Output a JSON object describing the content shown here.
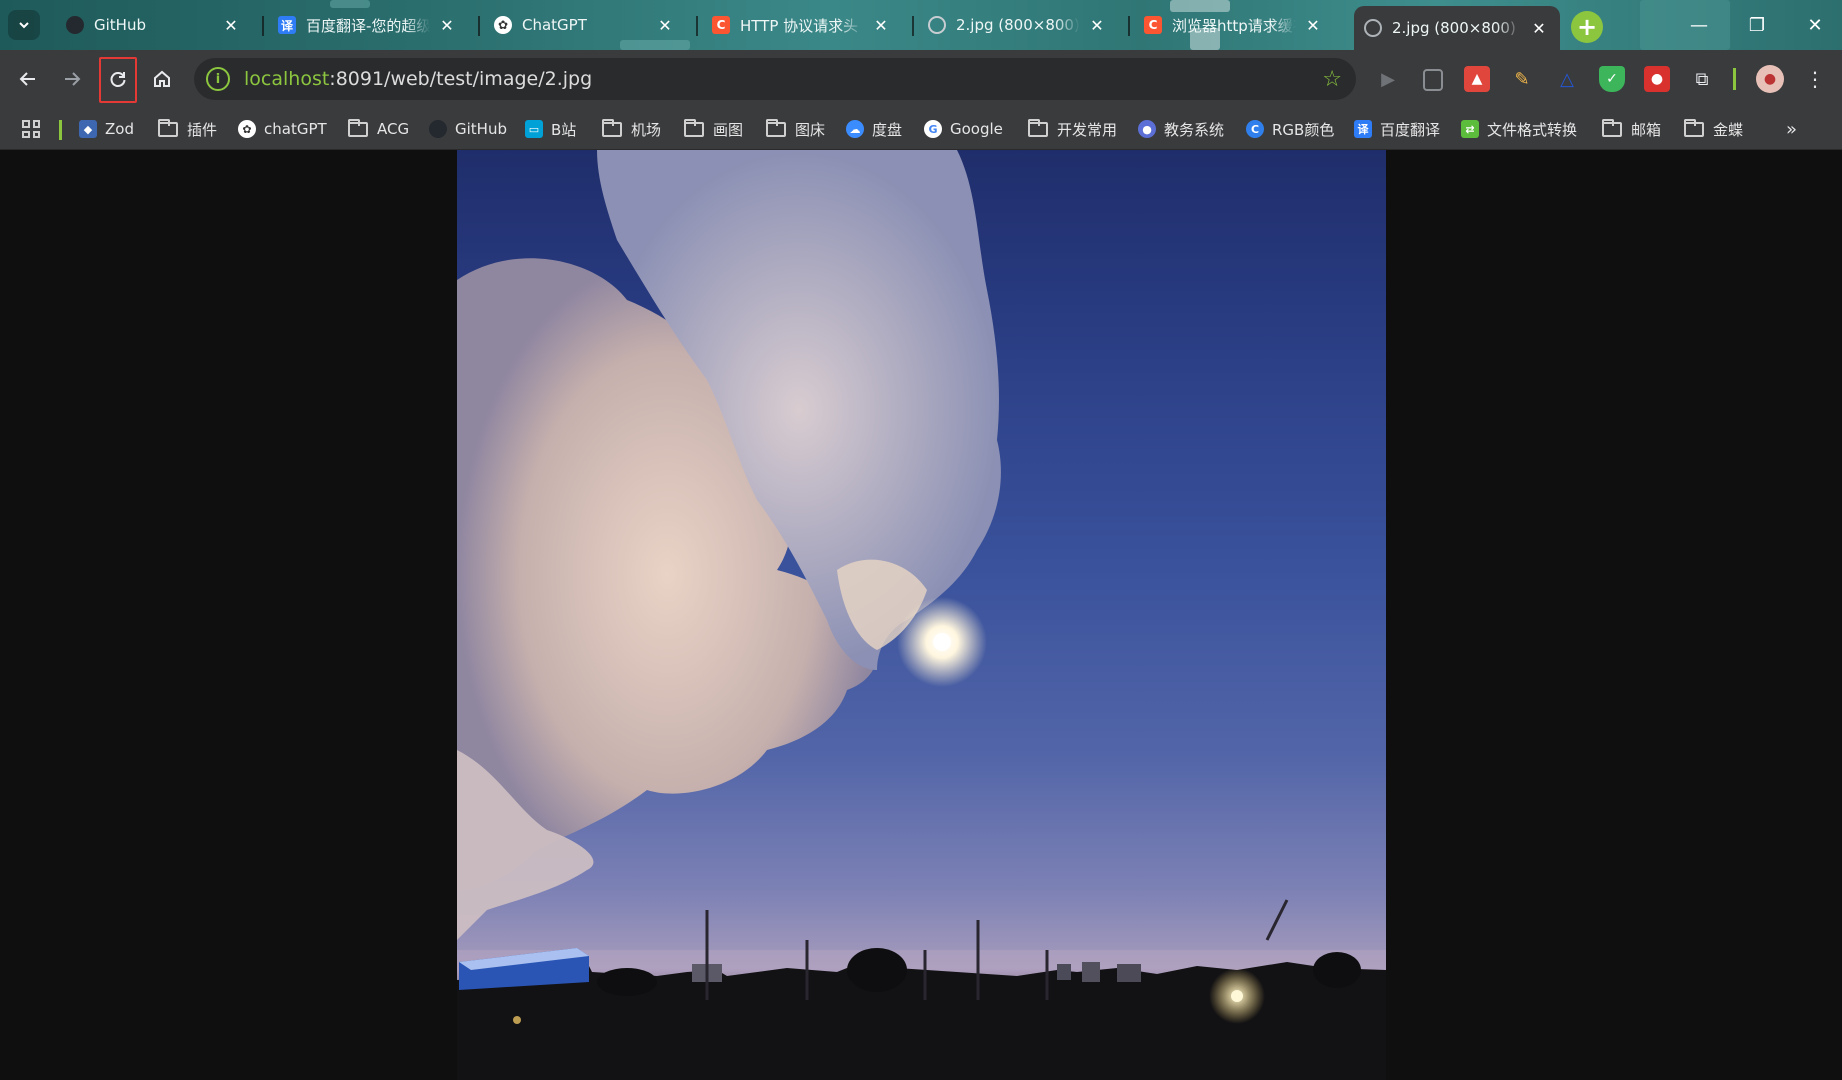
{
  "tabs": [
    {
      "title": "GitHub",
      "icon": "github-icon",
      "color": "#24292f"
    },
    {
      "title": "百度翻译-您的超级",
      "icon": "baidu-translate-icon",
      "glyph": "译",
      "color": "#2e7cf6"
    },
    {
      "title": "ChatGPT",
      "icon": "chatgpt-icon",
      "color": "#ffffff"
    },
    {
      "title": "HTTP 协议请求头",
      "icon": "csdn-icon",
      "glyph": "C",
      "color": "#fc5531"
    },
    {
      "title": "2.jpg (800×800)",
      "icon": "globe-icon",
      "color": "#9aa0a6"
    },
    {
      "title": "浏览器http请求缓存",
      "icon": "csdn-icon",
      "glyph": "C",
      "color": "#fc5531"
    },
    {
      "title": "2.jpg (800×800)",
      "icon": "globe-icon",
      "color": "#9aa0a6",
      "active": true
    }
  ],
  "address": {
    "host": "localhost",
    "path": ":8091/web/test/image/2.jpg"
  },
  "bookmarks": [
    {
      "label": "Zod",
      "icon": "zod-icon",
      "color": "#3e67b1"
    },
    {
      "label": "插件",
      "icon": "folder-icon"
    },
    {
      "label": "chatGPT",
      "icon": "chatgpt-icon",
      "color": "#ffffff"
    },
    {
      "label": "ACG",
      "icon": "folder-icon"
    },
    {
      "label": "GitHub",
      "icon": "github-icon",
      "color": "#24292f"
    },
    {
      "label": "B站",
      "icon": "bilibili-icon",
      "color": "#00a1d6"
    },
    {
      "label": "机场",
      "icon": "folder-icon"
    },
    {
      "label": "画图",
      "icon": "folder-icon"
    },
    {
      "label": "图床",
      "icon": "folder-icon"
    },
    {
      "label": "度盘",
      "icon": "baidu-pan-icon",
      "color": "#3b8cff"
    },
    {
      "label": "Google",
      "icon": "google-icon",
      "color": "#ffffff"
    },
    {
      "label": "开发常用",
      "icon": "folder-icon"
    },
    {
      "label": "教务系统",
      "icon": "school-icon",
      "color": "#5b6fd6"
    },
    {
      "label": "RGB颜色",
      "icon": "rgb-icon",
      "color": "#2f80ed"
    },
    {
      "label": "百度翻译",
      "icon": "baidu-translate-icon",
      "glyph": "译",
      "color": "#2e7cf6"
    },
    {
      "label": "文件格式转换",
      "icon": "convert-icon",
      "color": "#5cbc3b"
    },
    {
      "label": "邮箱",
      "icon": "folder-icon"
    },
    {
      "label": "金蝶",
      "icon": "folder-icon"
    }
  ],
  "colors": {
    "accent": "#8cc63f",
    "highlight": "#e53935",
    "toolbar": "#3a3b3d"
  }
}
